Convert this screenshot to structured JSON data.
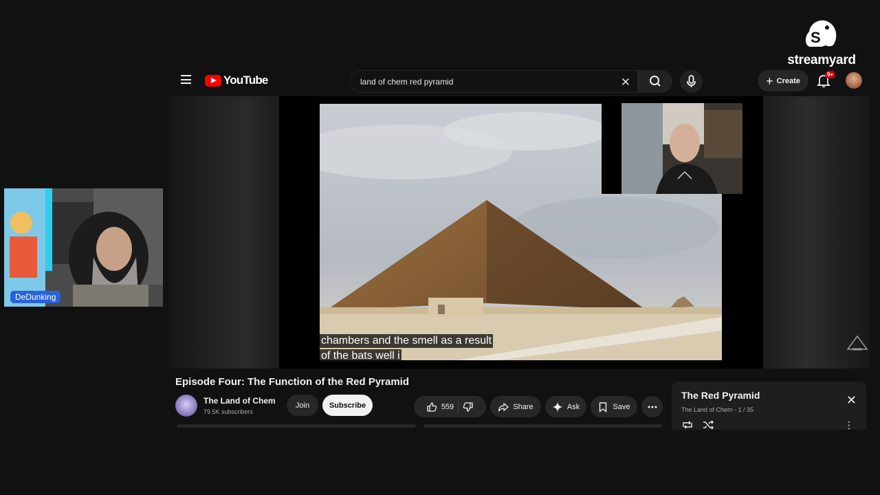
{
  "streamyard": {
    "wordmark": "streamyard"
  },
  "webcam": {
    "name_tag": "DeDunking"
  },
  "youtube": {
    "logo_text": "YouTube",
    "search": {
      "value": "land of chem red pyramid"
    },
    "create_label": "Create",
    "notifications_badge": "9+"
  },
  "player": {
    "captions": [
      "chambers and the smell as a result",
      "of the bats well i"
    ]
  },
  "video": {
    "title": "Episode Four: The Function of the Red Pyramid",
    "channel": {
      "name": "The Land of Chem",
      "subscribers": "79.5K subscribers"
    },
    "join_label": "Join",
    "subscribe_label": "Subscribe",
    "likes": "559",
    "share_label": "Share",
    "ask_label": "Ask",
    "save_label": "Save"
  },
  "playlist": {
    "title": "The Red Pyramid",
    "subtitle": "The Land of Chem - 1 / 35"
  },
  "colors": {
    "youtube_red": "#ff0000",
    "name_tag_blue": "#2a62d8",
    "background": "#111111"
  },
  "icons": [
    "hamburger-icon",
    "search-icon",
    "mic-icon",
    "close-icon",
    "plus-icon",
    "bell-icon",
    "thumbs-up-icon",
    "thumbs-down-icon",
    "share-icon",
    "sparkle-icon",
    "bookmark-icon",
    "more-horizontal-icon",
    "loop-icon",
    "shuffle-icon",
    "more-vertical-icon"
  ]
}
